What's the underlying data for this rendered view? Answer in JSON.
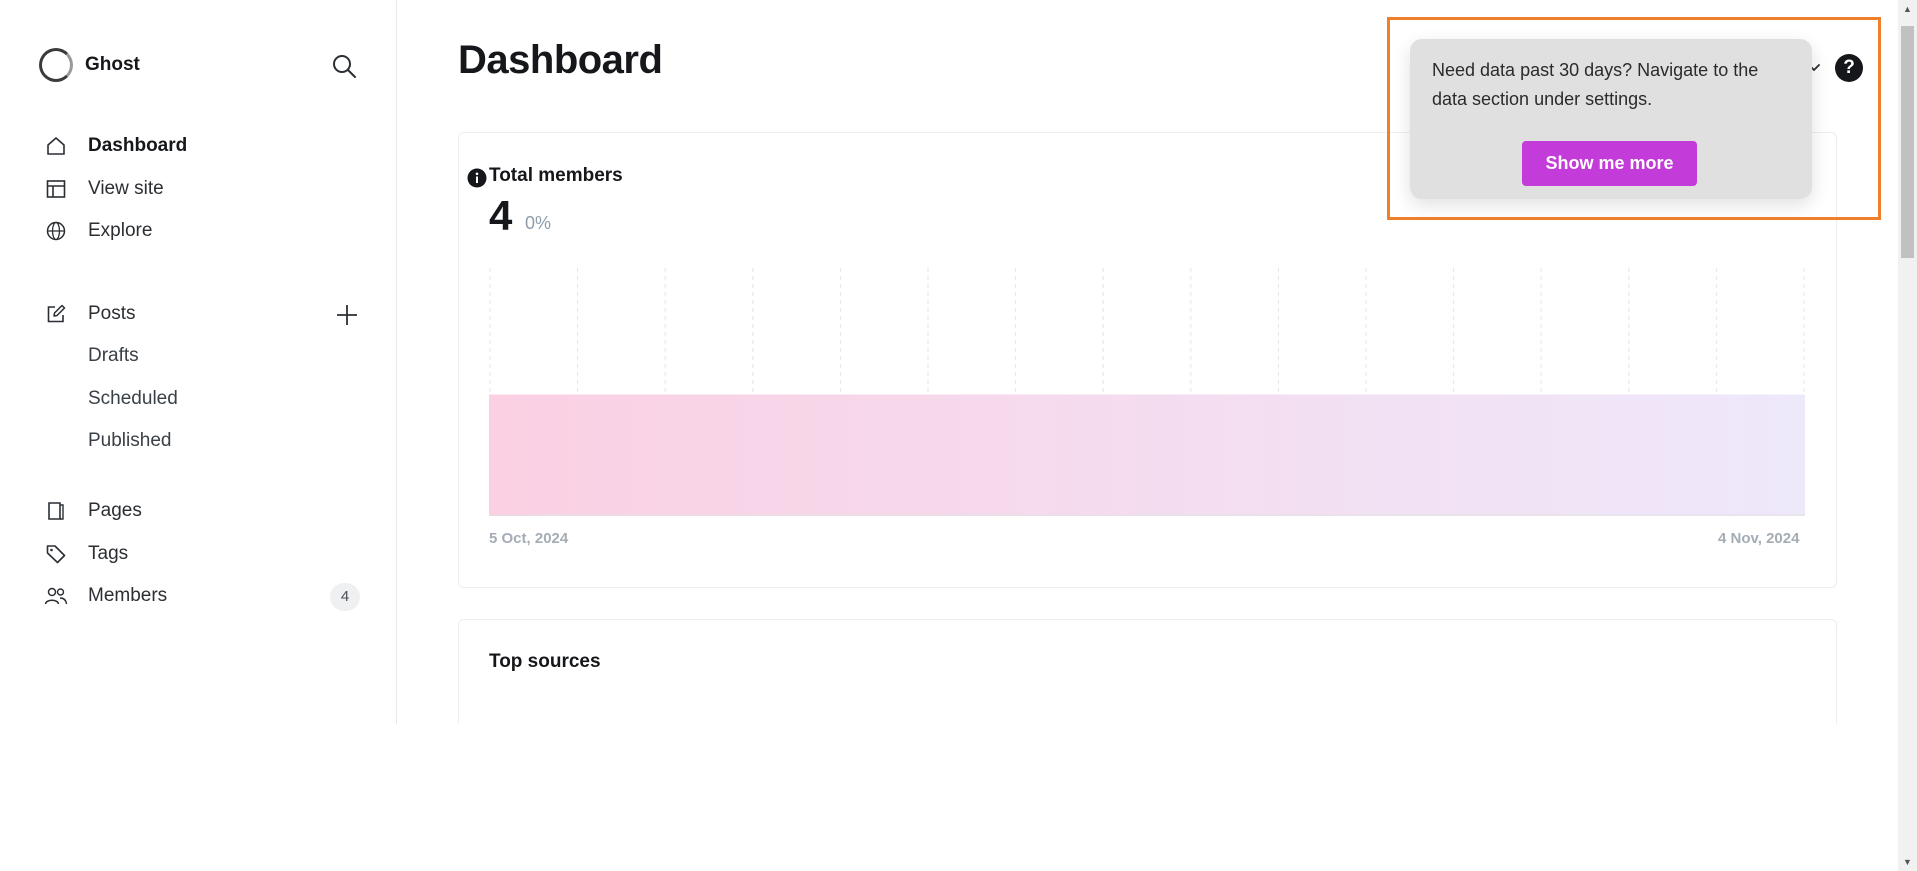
{
  "app": {
    "name": "Ghost"
  },
  "sidebar": {
    "items": [
      {
        "label": "Dashboard",
        "icon": "home-icon"
      },
      {
        "label": "View site",
        "icon": "layout-icon"
      },
      {
        "label": "Explore",
        "icon": "globe-icon"
      },
      {
        "label": "Posts",
        "icon": "pen-square-icon"
      },
      {
        "label": "Pages",
        "icon": "page-icon"
      },
      {
        "label": "Tags",
        "icon": "tag-icon"
      },
      {
        "label": "Members",
        "icon": "members-icon"
      }
    ],
    "post_subitems": [
      "Drafts",
      "Scheduled",
      "Published"
    ],
    "members_count": "4"
  },
  "main": {
    "title": "Dashboard",
    "total_members": {
      "label": "Total members",
      "value": "4",
      "change": "0%",
      "start_date": "5 Oct, 2024",
      "end_date": "4 Nov, 2024"
    },
    "top_sources": {
      "label": "Top sources"
    }
  },
  "tooltip": {
    "text": "Need data past 30 days? Navigate to the data section under settings.",
    "button_label": "Show me more"
  },
  "colors": {
    "accent": "#c33bd8",
    "highlight": "#ef7f2a",
    "line_start": "#e8367e",
    "line_end": "#8e42e0"
  },
  "chart_data": {
    "type": "area",
    "x": [
      "5 Oct, 2024",
      "4 Nov, 2024"
    ],
    "series": [
      {
        "values": [
          4,
          4
        ]
      }
    ]
  }
}
